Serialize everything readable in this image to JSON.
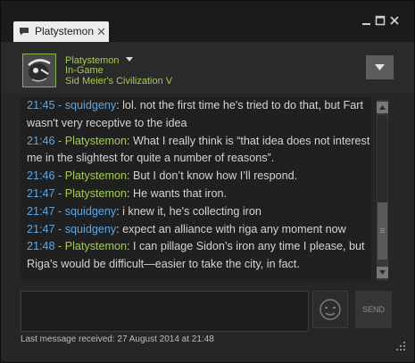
{
  "window": {
    "tab_label": "Platystemon"
  },
  "friend": {
    "name": "Platystemon",
    "status": "In-Game",
    "game": "Sid Meier's Civilization V"
  },
  "messages": [
    {
      "time": "21:45",
      "sep": " - ",
      "sender": "squidgeny",
      "text": ": lol. not the first time he's tried to do that, but Fart wasn't very receptive to the idea",
      "self": false
    },
    {
      "time": "21:46",
      "sep": " - ",
      "sender": "Platystemon",
      "text": ": What I really think is “that idea does not interest me in the slightest for quite a number of reasons”.",
      "self": true
    },
    {
      "time": "21:46",
      "sep": " - ",
      "sender": "Platystemon",
      "text": ": But I don’t know how I’ll respond.",
      "self": true
    },
    {
      "time": "21:47",
      "sep": " - ",
      "sender": "Platystemon",
      "text": ": He wants that iron.",
      "self": true
    },
    {
      "time": "21:47",
      "sep": " - ",
      "sender": "squidgeny",
      "text": ": i knew it, he's collecting iron",
      "self": false
    },
    {
      "time": "21:47",
      "sep": " - ",
      "sender": "squidgeny",
      "text": ": expect an alliance with riga any moment now",
      "self": false
    },
    {
      "time": "21:48",
      "sep": " - ",
      "sender": "Platystemon",
      "text": ": I can pillage Sidon’s iron any time I please, but Riga’s would be difficult—easier to take the city, in fact.",
      "self": true
    }
  ],
  "compose": {
    "send_label": "SEND",
    "value": ""
  },
  "footer": {
    "last_message": "Last message received: 27 August 2014 at 21:48"
  },
  "colors": {
    "self": "#a3cc4f",
    "other": "#5ea6e0",
    "text": "#d4d4d4",
    "background": "#262626"
  },
  "icons": {
    "tab": "chat-bubble-icon",
    "minimize": "minimize-icon",
    "maximize": "maximize-icon",
    "close": "close-icon",
    "dropdown": "chevron-down-icon",
    "emoticon": "emoticon-icon",
    "resize": "resize-grip-icon"
  }
}
